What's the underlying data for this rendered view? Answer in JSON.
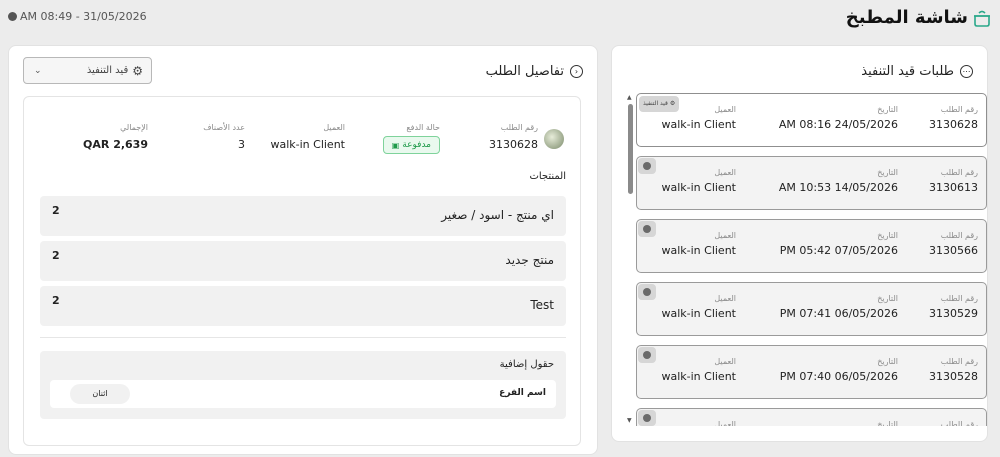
{
  "header": {
    "title": "شاشة المطبخ",
    "datetime": "AM 08:49 - 31/05/2026",
    "icons": {
      "app": "cooking-pot-icon",
      "clock": "clock-icon"
    }
  },
  "orders_panel": {
    "title": "طلبات قيد التنفيذ",
    "labels": {
      "order_no": "رقم الطلب",
      "date": "التاريخ",
      "customer": "العميل"
    },
    "orders": [
      {
        "order_no": "3130628",
        "date": "AM 08:16 24/05/2026",
        "customer": "walk-in Client",
        "status": "قيد التنفيذ"
      },
      {
        "order_no": "3130613",
        "date": "AM 10:53 14/05/2026",
        "customer": "walk-in Client"
      },
      {
        "order_no": "3130566",
        "date": "PM 05:42 07/05/2026",
        "customer": "walk-in Client"
      },
      {
        "order_no": "3130529",
        "date": "PM 07:41 06/05/2026",
        "customer": "walk-in Client"
      },
      {
        "order_no": "3130528",
        "date": "PM 07:40 06/05/2026",
        "customer": "walk-in Client"
      },
      {
        "order_no": "",
        "date": "",
        "customer": ""
      }
    ]
  },
  "details_panel": {
    "title": "تفاصيل الطلب",
    "status_select": "قيد التنفيذ",
    "info": {
      "order_no_label": "رقم الطلب",
      "order_no": "3130628",
      "payment_label": "حالة الدفع",
      "payment": "مدفوعة",
      "customer_label": "العميل",
      "customer": "walk-in Client",
      "items_label": "عدد الأصناف",
      "items": "3",
      "total_label": "الإجمالي",
      "total": "QAR 2,639"
    },
    "products_label": "المنتجات",
    "products": [
      {
        "name": "اي منتج - اسود / صغير",
        "qty": "2"
      },
      {
        "name": "منتج جديد",
        "qty": "2"
      },
      {
        "name": "Test",
        "qty": "2"
      }
    ],
    "extra_fields_label": "حقول إضافية",
    "extra_fields": [
      {
        "key": "اسم الفرع",
        "value": "اثنان"
      }
    ]
  },
  "colors": {
    "paid_text": "#1f9a4a",
    "paid_bg": "#e9f9ee",
    "paid_border": "#7fd39b"
  }
}
